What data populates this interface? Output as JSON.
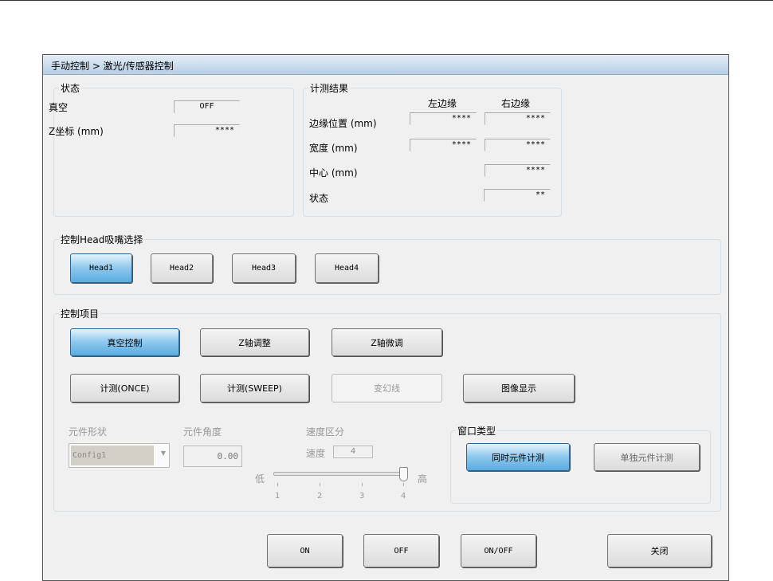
{
  "breadcrumb": "手动控制 > 激光/传感器控制",
  "status": {
    "title": "状态",
    "vacuum_label": "真空",
    "vacuum_value": "OFF",
    "z_label": "Z坐标 (mm)",
    "z_value": "****"
  },
  "measure": {
    "title": "计测结果",
    "col_left": "左边缘",
    "col_right": "右边缘",
    "edge_label": "边缘位置 (mm)",
    "edge_left": "****",
    "edge_right": "****",
    "width_label": "宽度 (mm)",
    "width_left": "****",
    "width_right": "****",
    "center_label": "中心 (mm)",
    "center_value": "****",
    "state_label": "状态",
    "state_value": "**"
  },
  "head": {
    "title": "控制Head吸嘴选择",
    "buttons": [
      "Head1",
      "Head2",
      "Head3",
      "Head4"
    ]
  },
  "control": {
    "title": "控制项目",
    "buttons": [
      "真空控制",
      "Z轴调整",
      "Z轴微调",
      "计测(ONCE)",
      "计测(SWEEP)",
      "变幻线",
      "图像显示"
    ],
    "shape_label": "元件形状",
    "shape_value": "Config1",
    "angle_label": "元件角度",
    "angle_value": "0.00",
    "speed_title": "速度区分",
    "speed_label": "速度",
    "speed_value": "4",
    "low": "低",
    "high": "高",
    "ticks": [
      "1",
      "2",
      "3",
      "4"
    ],
    "window_type": {
      "title": "窗口类型",
      "simultaneous": "同时元件计测",
      "single": "单独元件计测"
    }
  },
  "bottom": {
    "on": "ON",
    "off": "OFF",
    "onoff": "ON/OFF",
    "close": "关闭"
  }
}
